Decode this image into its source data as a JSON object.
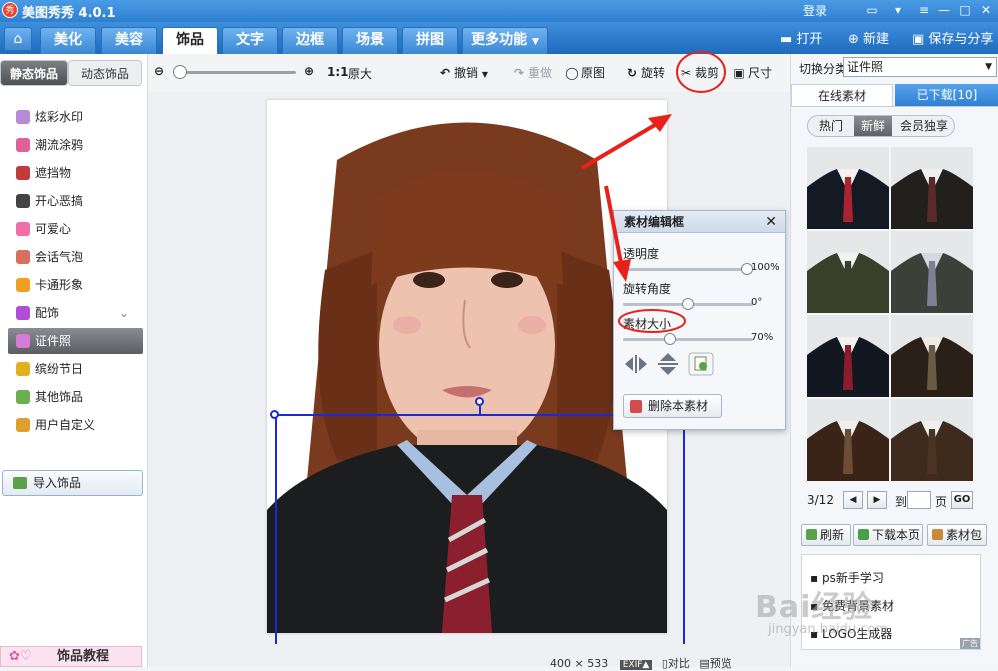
{
  "app": {
    "title": "美图秀秀 4.0.1",
    "logo_text": "秀",
    "login": "登录"
  },
  "tabs": [
    {
      "label": "美化"
    },
    {
      "label": "美容"
    },
    {
      "label": "饰品"
    },
    {
      "label": "文字"
    },
    {
      "label": "边框"
    },
    {
      "label": "场景"
    },
    {
      "label": "拼图"
    },
    {
      "label": "更多功能"
    }
  ],
  "active_tab": "饰品",
  "top_actions": {
    "open": "打开",
    "new": "新建",
    "save_share": "保存与分享"
  },
  "left": {
    "subtabs": [
      "静态饰品",
      "动态饰品"
    ],
    "categories": [
      {
        "label": "炫彩水印",
        "color": "#b58ad6"
      },
      {
        "label": "潮流涂鸦",
        "color": "#e0609a"
      },
      {
        "label": "遮挡物",
        "color": "#c23a3a"
      },
      {
        "label": "开心恶搞",
        "color": "#444444"
      },
      {
        "label": "可爱心",
        "color": "#f06fa8"
      },
      {
        "label": "会话气泡",
        "color": "#d96f5f"
      },
      {
        "label": "卡通形象",
        "color": "#f0a020"
      },
      {
        "label": "配饰",
        "color": "#b04fd6"
      },
      {
        "label": "证件照",
        "color": "#d57ad6"
      },
      {
        "label": "缤纷节日",
        "color": "#e0b020"
      },
      {
        "label": "其他饰品",
        "color": "#6ab04f"
      },
      {
        "label": "用户自定义",
        "color": "#e0a030"
      }
    ],
    "active_category": "证件照",
    "import_label": "导入饰品",
    "tutorial_label": "饰品教程"
  },
  "toolbar": {
    "ratio": "1:1",
    "original_size": "原大",
    "undo": "撤销",
    "redo": "重做",
    "original": "原图",
    "rotate": "旋转",
    "crop": "裁剪",
    "size": "尺寸"
  },
  "editor": {
    "title": "素材编辑框",
    "opacity_label": "透明度",
    "opacity_value": "100%",
    "opacity_level": 1.0,
    "rotation_label": "旋转角度",
    "rotation_value": "0°",
    "rotation_level": 0.5,
    "size_label": "素材大小",
    "size_value": "70%",
    "size_level": 0.35,
    "delete_label": "删除本素材"
  },
  "right": {
    "switch_label": "切换分类",
    "switch_value": "证件照",
    "tabs": [
      "在线素材",
      "已下载[10]"
    ],
    "filters": [
      "热门",
      "新鲜",
      "会员独享"
    ],
    "active_filter": "新鲜",
    "page": "3/12",
    "goto_label": "到",
    "page_unit": "页",
    "go": "GO",
    "refresh": "刷新",
    "download_page": "下载本页",
    "material_pack": "素材包",
    "ads": [
      "ps新手学习",
      "免费背景素材",
      "LOGO生成器"
    ],
    "ad_tag": "广告"
  },
  "status": {
    "width": "400",
    "x": "×",
    "height": "533",
    "exif": "EXIF▲",
    "compare": "对比",
    "preview": "预览"
  },
  "watermark": {
    "brand": "Bai经验",
    "url": "jingyan.baidu.com"
  },
  "colors": {
    "title_blue": "#2f7fd0",
    "annotation_red": "#e8211b",
    "selection_blue": "#1a2bd6"
  }
}
